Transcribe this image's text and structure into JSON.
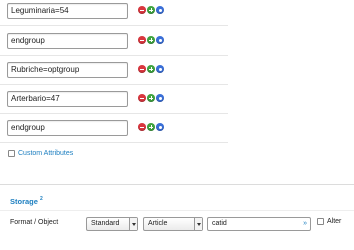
{
  "rows": [
    {
      "value": "Leguminaria=54"
    },
    {
      "value": "endgroup"
    },
    {
      "value": "Rubriche=optgroup"
    },
    {
      "value": "Arterbario=47"
    },
    {
      "value": "endgroup"
    }
  ],
  "custom_attributes": {
    "label": "Custom Attributes"
  },
  "storage": {
    "title": "Storage",
    "title_sup": "2",
    "format_label": "Format / Object",
    "format_select": "Standard",
    "object_select": "Article",
    "field_value": "catid",
    "field_suffix": "»",
    "alter_label": "Alter"
  },
  "icons": {
    "remove": "minus-circle-icon",
    "add": "plus-circle-icon",
    "options": "options-circle-icon"
  },
  "colors": {
    "link": "#1d7fc0",
    "remove": "#d9363e",
    "add": "#3fa33f",
    "options": "#3a6fd8"
  }
}
